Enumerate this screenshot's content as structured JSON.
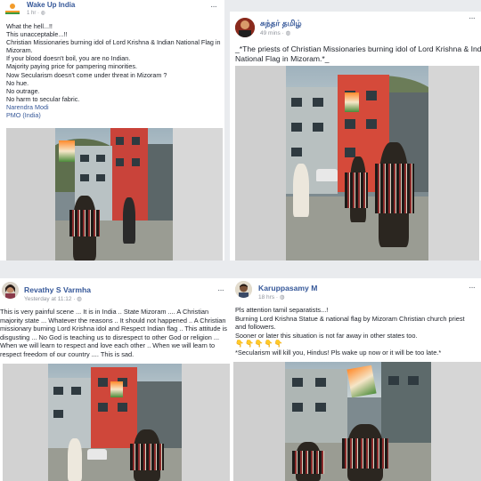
{
  "posts": [
    {
      "page_name": "Wake Up India",
      "time": "1 hr",
      "lines": [
        "What the hell...!!",
        "This unacceptable...!!",
        "Christian Missionaries burning idol of Lord Krishna & Indian National Flag in",
        "Mizoram.",
        "If your blood doesn't boil, you are no Indian.",
        "Majority paying price for pampering minorities.",
        "Now Secularism doesn't come under threat in Mizoram ?",
        "No hue.",
        "No outrage.",
        "No harm to secular fabric."
      ],
      "tags": [
        "Narendra Modi",
        "PMO (India)"
      ],
      "more_label": "···"
    },
    {
      "page_name": "சுந்தர் தமிழ்",
      "time": "49 mins",
      "lines": [
        "_*The priests of Christian Missionaries burning idol of Lord Krishna & Indian",
        "National Flag in Mizoram.*_"
      ],
      "more_label": "···"
    },
    {
      "page_name": "Revathy S Varmha",
      "time": "Yesterday at 11:12",
      "lines": [
        "This is very painful scene ... It is in India .. State Mizoram .... A Christian",
        "majority state ... Whatever the reasons .. It should not happened .. A Christian",
        "missionary burning Lord Krishna idol and Respect Indian flag .. This attitude is",
        "disgusting ... No God is teaching us to disrespect to other God or religion ...",
        "When we will learn to respect and love each other .. When we will learn to",
        "respect freedom of our country .... This is sad."
      ],
      "more_label": "···"
    },
    {
      "page_name": "Karuppasamy M",
      "time": "18 hrs",
      "lines": [
        "Pls attention tamil separatists...!",
        "Burning Lord Krishna Statue & national flag by Mizoram Christian church priest",
        "and followers.",
        "Sooner or later this situation is not far away in other states too.",
        "👇👇👇👇👇",
        "*Secularism will kill you, Hindus! Pls wake up now or it will be too late.*"
      ],
      "more_label": "···"
    }
  ],
  "colors": {
    "background": "#e9ebee",
    "link": "#365899",
    "meta": "#90949c",
    "text": "#1d2129"
  }
}
